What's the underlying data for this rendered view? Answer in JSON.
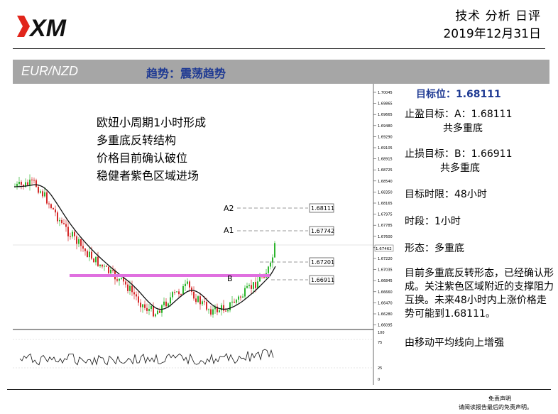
{
  "header": {
    "logo_text": "XM",
    "title": "技术 分析 日评",
    "date": "2019年12月31日"
  },
  "banner": {
    "pair": "EUR/NZD",
    "trend": "趋势：震荡趋势"
  },
  "chart_notes": {
    "lines": [
      "欧妞小周期1小时形成",
      "多重底反转结构",
      "价格目前确认破位",
      "稳健者紫色区域进场"
    ]
  },
  "chart_labels": {
    "a2": "A2",
    "a1": "A1",
    "b": "B",
    "a2_price": "1.68111",
    "a1_price": "1.67742",
    "current_price": "1.67201",
    "b_price": "1.66911",
    "price_axis": [
      "1.70045",
      "1.69865",
      "1.69665",
      "1.69480",
      "1.69290",
      "1.69105",
      "1.68915",
      "1.68725",
      "1.68540",
      "1.68350",
      "1.68165",
      "1.67975",
      "1.67785",
      "1.67600",
      "1.67410",
      "1.67220",
      "1.67035",
      "1.66845",
      "1.66660",
      "1.66470",
      "1.66280",
      "1.66095"
    ],
    "osc_axis": [
      "100",
      "75",
      "25",
      "0"
    ],
    "last_price_tag": "1.67462"
  },
  "analysis": {
    "target_level": "目标位：1.68111",
    "take_profit": "止盈目标：A：1.68111",
    "take_profit_basis": "共多重底",
    "stop_loss": "止损目标：B：1.66911",
    "stop_loss_basis": "共多重底",
    "time_limit": "目标时限：48小时",
    "timeframe": "时段：1小时",
    "pattern": "形态：多重底",
    "summary": "目前多重底反转形态，已经确认形成。关注紫色区域附近的支撑阻力互换。未来48小时内上涨价格走势可能到1.68111。",
    "ma_note": "由移动平均线向上增强"
  },
  "footer": {
    "disclaimer_title": "免责声明",
    "disclaimer_text": "请阅读报告最后的免责声明。"
  },
  "colors": {
    "brand_red": "#e1251b",
    "banner_gray": "#a6a6a6",
    "trend_blue": "#1f3a93",
    "support_zone": "#e070e0",
    "bull_candle": "#2db52d",
    "bear_candle": "#d42a2a"
  }
}
